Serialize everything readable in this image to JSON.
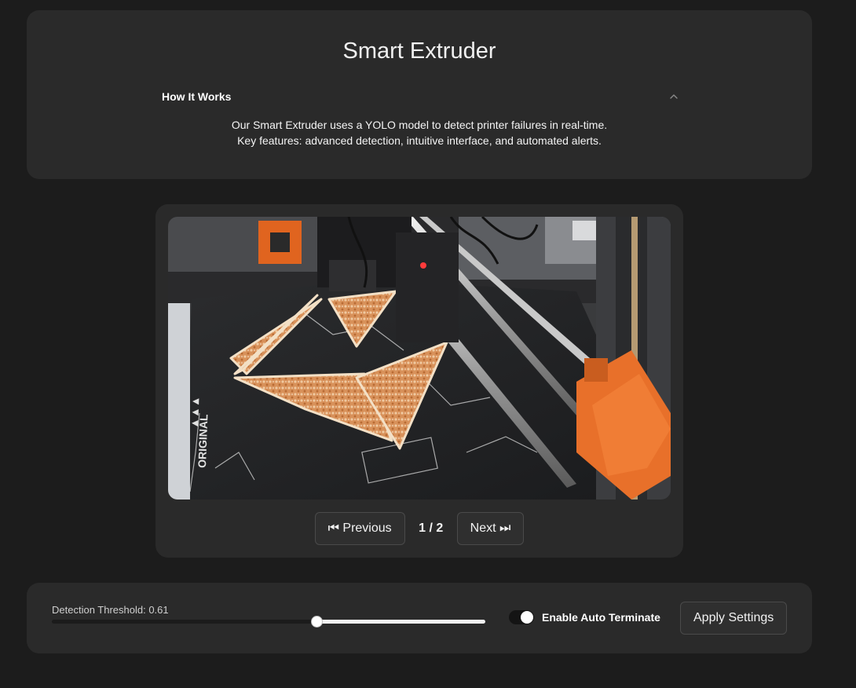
{
  "header": {
    "title": "Smart Extruder",
    "accordion": {
      "title": "How It Works",
      "expanded": true,
      "lines": [
        "Our Smart Extruder uses a YOLO model to detect printer failures in real-time.",
        "Key features: advanced detection, intuitive interface, and automated alerts."
      ]
    }
  },
  "viewer": {
    "image_description": "Camera view of a 3D printer bed with orange triangular prints",
    "pager": {
      "previous_label": "⏮ Previous",
      "next_label": "Next ⏭",
      "indicator": "1 / 2",
      "current_page": 1,
      "total_pages": 2
    }
  },
  "settings": {
    "threshold_label": "Detection Threshold: 0.61",
    "threshold_value": 0.61,
    "auto_terminate_label": "Enable Auto Terminate",
    "auto_terminate_enabled": true,
    "apply_label": "Apply Settings"
  },
  "colors": {
    "background": "#1c1c1c",
    "card": "#2a2a2a",
    "accent_orange": "#e8702a"
  }
}
